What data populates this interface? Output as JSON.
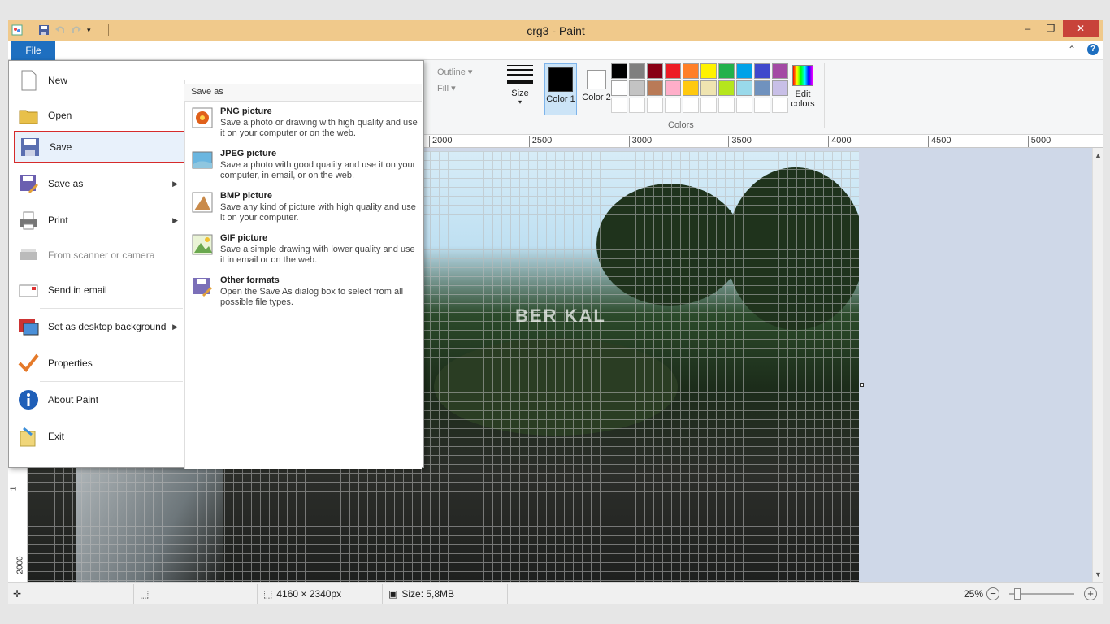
{
  "window": {
    "title": "crg3 - Paint",
    "min": "‒",
    "restore": "❐",
    "close": "✕"
  },
  "tabs": {
    "file": "File"
  },
  "ribbon": {
    "outline": "Outline ▾",
    "fill": "Fill ▾",
    "size": "Size",
    "color1": "Color 1",
    "color2": "Color 2",
    "edit_colors": "Edit colors",
    "colors_group": "Colors",
    "palette_row1": [
      "#000000",
      "#7f7f7f",
      "#880015",
      "#ed1c24",
      "#ff7f27",
      "#fff200",
      "#22b14c",
      "#00a2e8",
      "#3f48cc",
      "#a349a4"
    ],
    "palette_row2": [
      "#ffffff",
      "#c3c3c3",
      "#b97a57",
      "#ffaec9",
      "#ffc90e",
      "#efe4b0",
      "#b5e61d",
      "#99d9ea",
      "#7092be",
      "#c8bfe7"
    ]
  },
  "ruler": {
    "ticks": [
      "2000",
      "2500",
      "3000",
      "3500",
      "4000",
      "4500",
      "5000"
    ],
    "vticks": [
      "1",
      "2000"
    ]
  },
  "canvas": {
    "watermark": "BER KAL"
  },
  "status": {
    "dimensions": "4160 × 2340px",
    "size": "Size: 5,8MB",
    "zoom": "25%"
  },
  "file_menu": {
    "items": [
      {
        "label": "New",
        "icon": "new-file-icon"
      },
      {
        "label": "Open",
        "icon": "open-folder-icon"
      },
      {
        "label": "Save",
        "icon": "save-disk-icon"
      },
      {
        "label": "Save as",
        "icon": "save-as-icon"
      },
      {
        "label": "Print",
        "icon": "printer-icon"
      },
      {
        "label": "From scanner or camera",
        "icon": "scanner-icon"
      },
      {
        "label": "Send in email",
        "icon": "email-icon"
      },
      {
        "label": "Set as desktop background",
        "icon": "desktop-background-icon"
      },
      {
        "label": "Properties",
        "icon": "checkmark-icon"
      },
      {
        "label": "About Paint",
        "icon": "info-icon"
      },
      {
        "label": "Exit",
        "icon": "exit-icon"
      }
    ],
    "save_as": {
      "header": "Save as",
      "options": [
        {
          "title": "PNG picture",
          "desc": "Save a photo or drawing with high quality and use it on your computer or on the web."
        },
        {
          "title": "JPEG picture",
          "desc": "Save a photo with good quality and use it on your computer, in email, or on the web."
        },
        {
          "title": "BMP picture",
          "desc": "Save any kind of picture with high quality and use it on your computer."
        },
        {
          "title": "GIF picture",
          "desc": "Save a simple drawing with lower quality and use it in email or on the web."
        },
        {
          "title": "Other formats",
          "desc": "Open the Save As dialog box to select from all possible file types."
        }
      ]
    }
  }
}
